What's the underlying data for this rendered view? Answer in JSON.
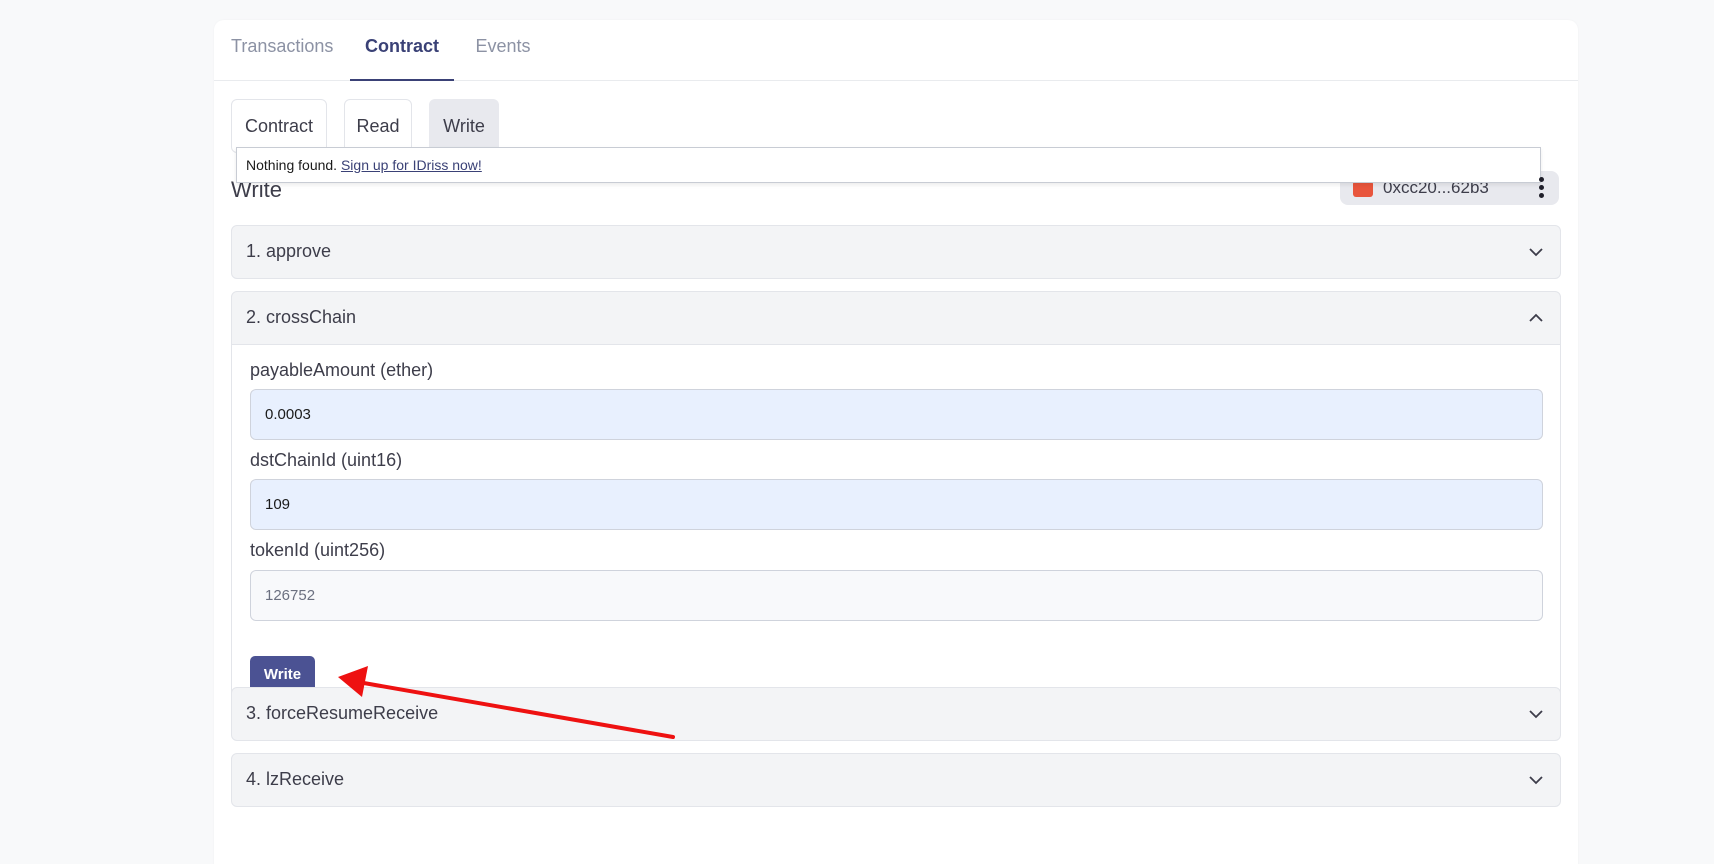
{
  "tabs": {
    "main": [
      "Transactions",
      "Contract",
      "Events"
    ],
    "sub": [
      "Contract",
      "Read",
      "Write"
    ]
  },
  "search_dropdown": {
    "message": "Nothing found.",
    "link": "Sign up for IDriss now!"
  },
  "section": {
    "title": "Write",
    "wallet_address": "0xcc20...62b3"
  },
  "functions": [
    {
      "label": "1. approve"
    },
    {
      "label": "2. crossChain"
    },
    {
      "label": "3. forceResumeReceive"
    },
    {
      "label": "4. lzReceive"
    }
  ],
  "crossChain": {
    "fields": [
      {
        "label": "payableAmount (ether)",
        "value": "0.0003",
        "placeholder": ""
      },
      {
        "label": "dstChainId (uint16)",
        "value": "109",
        "placeholder": ""
      },
      {
        "label": "tokenId (uint256)",
        "value": "",
        "placeholder": "126752"
      }
    ],
    "submit_label": "Write"
  },
  "colors": {
    "accent": "#3a4176",
    "button": "#4b5293",
    "annotation_arrow": "#ee1111",
    "filled_input": "#e8f0fe"
  }
}
